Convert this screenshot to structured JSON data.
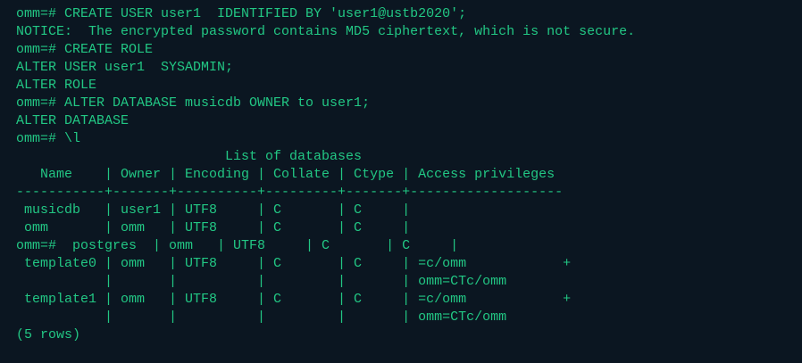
{
  "terminal": {
    "colors": {
      "background": "#0b1621",
      "text": "#22c784"
    },
    "lines": [
      "omm=# CREATE USER user1  IDENTIFIED BY 'user1@ustb2020';",
      "NOTICE:  The encrypted password contains MD5 ciphertext, which is not secure.",
      "omm=# CREATE ROLE",
      "ALTER USER user1  SYSADMIN;",
      "ALTER ROLE",
      "omm=# ALTER DATABASE musicdb OWNER to user1;",
      "ALTER DATABASE",
      "omm=# \\l",
      "                          List of databases",
      "   Name    | Owner | Encoding | Collate | Ctype | Access privileges",
      "-----------+-------+----------+---------+-------+-------------------",
      " musicdb   | user1 | UTF8     | C       | C     |",
      " omm       | omm   | UTF8     | C       | C     |",
      "omm=#  postgres  | omm   | UTF8     | C       | C     |",
      " template0 | omm   | UTF8     | C       | C     | =c/omm            +",
      "           |       |          |         |       | omm=CTc/omm",
      " template1 | omm   | UTF8     | C       | C     | =c/omm            +",
      "           |       |          |         |       | omm=CTc/omm",
      "(5 rows)"
    ]
  }
}
